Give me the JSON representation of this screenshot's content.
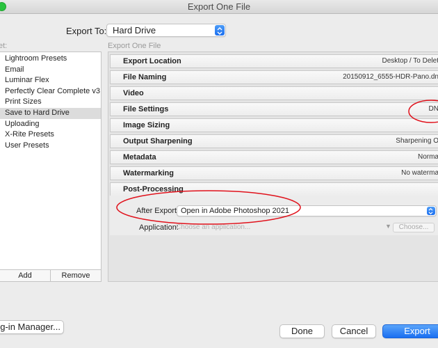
{
  "window": {
    "title": "Export One File"
  },
  "export_to": {
    "label": "Export To:",
    "value": "Hard Drive"
  },
  "preset_caption": "et:",
  "export_caption": "Export One File",
  "presets": [
    "Lightroom Presets",
    "Email",
    "Luminar Flex",
    "Perfectly Clear Complete v3",
    "Print Sizes",
    "Save to Hard Drive",
    "Uploading",
    "X-Rite Presets",
    "User Presets"
  ],
  "selected_preset": "Save to Hard Drive",
  "preset_buttons": {
    "add": "Add",
    "remove": "Remove"
  },
  "sections": [
    {
      "title": "Export Location",
      "summary": "Desktop / To Delet"
    },
    {
      "title": "File Naming",
      "summary": "20150912_6555-HDR-Pano.dn"
    },
    {
      "title": "Video",
      "summary": ""
    },
    {
      "title": "File Settings",
      "summary": "DN"
    },
    {
      "title": "Image Sizing",
      "summary": ""
    },
    {
      "title": "Output Sharpening",
      "summary": "Sharpening O"
    },
    {
      "title": "Metadata",
      "summary": "Norma"
    },
    {
      "title": "Watermarking",
      "summary": "No waterma"
    },
    {
      "title": "Post-Processing",
      "summary": ""
    }
  ],
  "post_processing": {
    "after_export_label": "After Export:",
    "after_export_value": "Open in Adobe Photoshop 2021",
    "application_label": "Application:",
    "application_placeholder": "Choose an application...",
    "choose_button": "Choose..."
  },
  "footer": {
    "plugin_manager": "ug-in Manager...",
    "done": "Done",
    "cancel": "Cancel",
    "export": "Export"
  },
  "colors": {
    "accent": "#1a6ff1",
    "annotation": "#e0101a",
    "selected_row": "#dcdcdc"
  }
}
